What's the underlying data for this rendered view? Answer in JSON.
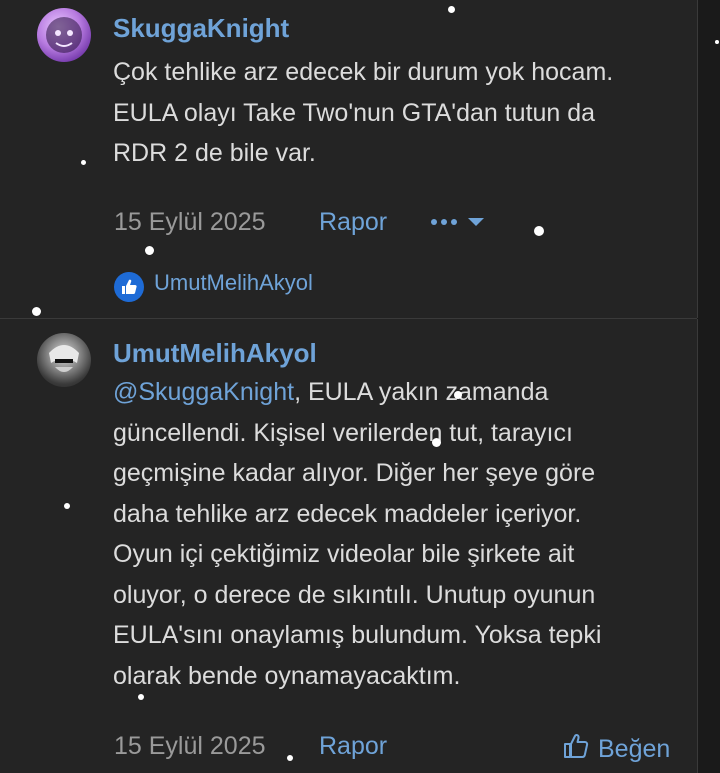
{
  "post1": {
    "username": "SkuggaKnight",
    "lines": [
      "Çok tehlike arz edecek bir durum yok hocam.",
      "EULA olayı Take Two'nun GTA'dan tutun da",
      "RDR 2 de bile var."
    ],
    "date": "15 Eylül 2025",
    "report_label": "Rapor",
    "more_icon": "ellipsis-dropdown-icon",
    "liker": "UmutMelihAkyol"
  },
  "post2": {
    "username": "UmutMelihAkyol",
    "mention": "@SkuggaKnight",
    "lines": [
      ", EULA yakın zamanda",
      "güncellendi. Kişisel verilerden tut, tarayıcı",
      "geçmişine kadar alıyor. Diğer her şeye göre",
      "daha tehlike arz edecek maddeler içeriyor.",
      "Oyun içi çektiğimiz videolar bile şirkete ait",
      "oluyor, o derece de sıkıntılı. Unutup oyunun",
      "EULA'sını onaylamış bulundum. Yoksa tepki",
      "olarak bende oynamayacaktım."
    ],
    "date": "15 Eylül 2025",
    "report_label": "Rapor",
    "like_label": "Beğen"
  },
  "colors": {
    "link": "#6fa3d8",
    "background": "#242424",
    "text": "#dcdcdc",
    "meta": "#9a9a9a"
  }
}
